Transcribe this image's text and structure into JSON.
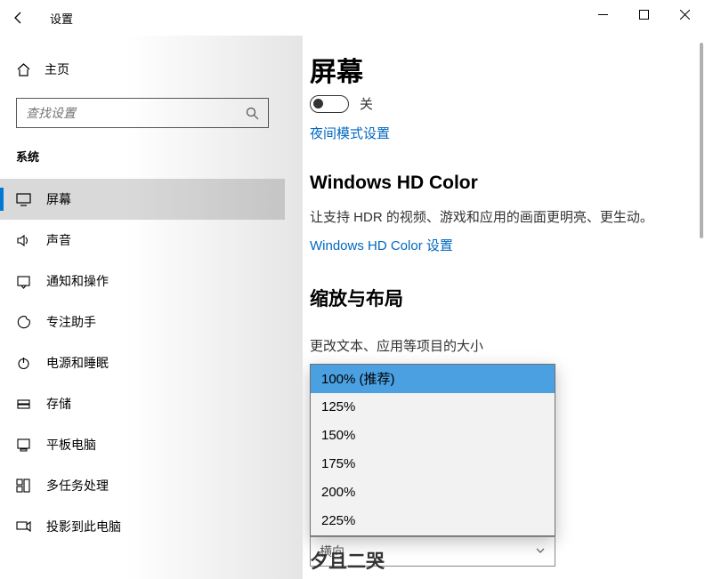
{
  "window": {
    "title": "设置"
  },
  "sidebar": {
    "home_label": "主页",
    "search_placeholder": "查找设置",
    "section": "系统",
    "items": [
      {
        "label": "屏幕",
        "icon": "display-icon",
        "active": true
      },
      {
        "label": "声音",
        "icon": "sound-icon",
        "active": false
      },
      {
        "label": "通知和操作",
        "icon": "notifications-icon",
        "active": false
      },
      {
        "label": "专注助手",
        "icon": "focus-icon",
        "active": false
      },
      {
        "label": "电源和睡眠",
        "icon": "power-icon",
        "active": false
      },
      {
        "label": "存储",
        "icon": "storage-icon",
        "active": false
      },
      {
        "label": "平板电脑",
        "icon": "tablet-icon",
        "active": false
      },
      {
        "label": "多任务处理",
        "icon": "multitask-icon",
        "active": false
      },
      {
        "label": "投影到此电脑",
        "icon": "project-icon",
        "active": false
      }
    ]
  },
  "content": {
    "page_title": "屏幕",
    "toggle_off_label": "关",
    "night_light_link": "夜间模式设置",
    "hd_section_title": "Windows HD Color",
    "hd_section_desc": "让支持 HDR 的视频、游戏和应用的画面更明亮、更生动。",
    "hd_color_link": "Windows HD Color 设置",
    "scale_section_title": "缩放与布局",
    "scale_field_label": "更改文本、应用等项目的大小",
    "scale_options": [
      "100% (推荐)",
      "125%",
      "150%",
      "175%",
      "200%",
      "225%"
    ],
    "scale_selected": "100% (推荐)",
    "combo_under_text": "横向",
    "next_section_peek": "夕且二哭"
  }
}
